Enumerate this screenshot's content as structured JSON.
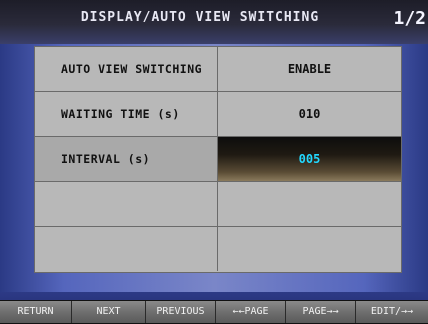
{
  "header": {
    "title": "DISPLAY/AUTO VIEW SWITCHING",
    "page": "1/2"
  },
  "settings": [
    {
      "label": "AUTO VIEW SWITCHING",
      "value": "ENABLE",
      "selected": false
    },
    {
      "label": "WAITING TIME (s)",
      "value": "010",
      "selected": false
    },
    {
      "label": "INTERVAL (s)",
      "value": "005",
      "selected": true
    },
    {
      "label": "",
      "value": "",
      "selected": false
    },
    {
      "label": "",
      "value": "",
      "selected": false
    }
  ],
  "footer": {
    "buttons": [
      "RETURN",
      "NEXT",
      "PREVIOUS",
      "←←PAGE",
      "PAGE→→",
      "EDIT/→→"
    ]
  },
  "colors": {
    "highlight_text": "#22d8ff",
    "table_bg": "#b8b8b8"
  }
}
